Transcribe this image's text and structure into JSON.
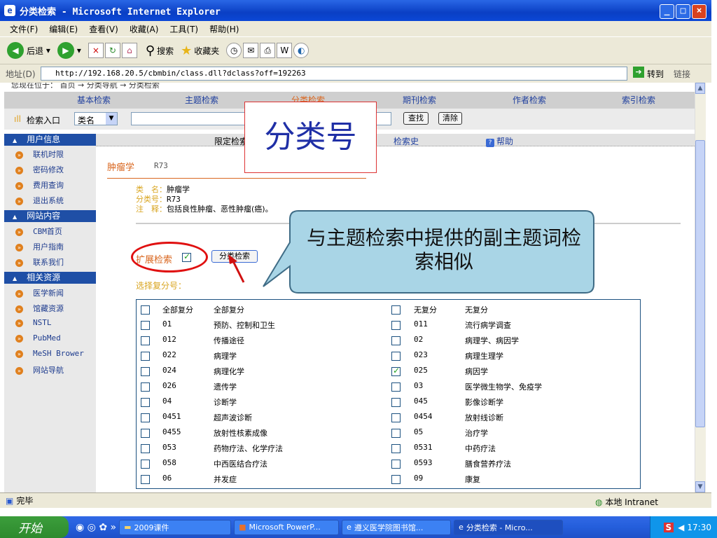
{
  "window": {
    "title": "分类检索 - Microsoft Internet Explorer"
  },
  "menu": [
    "文件(F)",
    "编辑(E)",
    "查看(V)",
    "收藏(A)",
    "工具(T)",
    "帮助(H)"
  ],
  "toolbar": {
    "back": "后退",
    "search": "搜索",
    "favorites": "收藏夹"
  },
  "address": {
    "label": "地址(D)",
    "url": "http://192.168.20.5/cbmbin/class.dll?dclass?off=192263",
    "go": "转到",
    "links": "链接"
  },
  "breadcrumb": "您现在位于： 首页 → 分类导航 → 分类检索",
  "nav": {
    "tabs": [
      "基本检索",
      "主题检索",
      "分类检索",
      "期刊检索",
      "作者检索",
      "索引检索"
    ]
  },
  "searchbar": {
    "label": "检索入口",
    "select": "类名",
    "find": "查找",
    "clear": "清除"
  },
  "subnav": {
    "limit": "限定检索",
    "history": "检索史",
    "help": "帮助"
  },
  "sidebar": {
    "sections": [
      {
        "title": "用户信息",
        "items": [
          "联机时限",
          "密码修改",
          "费用查询",
          "退出系统"
        ]
      },
      {
        "title": "网站内容",
        "items": [
          "CBM首页",
          "用户指南",
          "联系我们"
        ]
      },
      {
        "title": "相关资源",
        "items": [
          "医学新闻",
          "馆藏资源",
          "NSTL",
          "PubMed",
          "MeSH Brower",
          "网站导航"
        ]
      }
    ]
  },
  "category": {
    "name": "肿瘤学",
    "code": "R73"
  },
  "info": {
    "name_label": "类　名：",
    "name": "肿瘤学",
    "code_label": "分类号：",
    "code": "R73",
    "note_label": "注　释：",
    "note": "包括良性肿瘤、恶性肿瘤(癌)。"
  },
  "expand": {
    "label": "扩展检索",
    "button": "分类检索",
    "select_label": "选择复分号："
  },
  "subdivisions": [
    {
      "code": "全部复分",
      "name": "全部复分",
      "code2": "无复分",
      "name2": "无复分",
      "on2": false
    },
    {
      "code": "01",
      "name": "预防、控制和卫生",
      "code2": "011",
      "name2": "流行病学调查",
      "on2": false
    },
    {
      "code": "012",
      "name": "传播途径",
      "code2": "02",
      "name2": "病理学、病因学",
      "on2": false
    },
    {
      "code": "022",
      "name": "病理学",
      "code2": "023",
      "name2": "病理生理学",
      "on2": false
    },
    {
      "code": "024",
      "name": "病理化学",
      "code2": "025",
      "name2": "病因学",
      "on2": true
    },
    {
      "code": "026",
      "name": "遗传学",
      "code2": "03",
      "name2": "医学微生物学、免疫学",
      "on2": false
    },
    {
      "code": "04",
      "name": "诊断学",
      "code2": "045",
      "name2": "影像诊断学",
      "on2": false
    },
    {
      "code": "0451",
      "name": "超声波诊断",
      "code2": "0454",
      "name2": "放射线诊断",
      "on2": false
    },
    {
      "code": "0455",
      "name": "放射性核素成像",
      "code2": "05",
      "name2": "治疗学",
      "on2": false
    },
    {
      "code": "053",
      "name": "药物疗法、化学疗法",
      "code2": "0531",
      "name2": "中药疗法",
      "on2": false
    },
    {
      "code": "058",
      "name": "中西医结合疗法",
      "code2": "0593",
      "name2": "膳食营养疗法",
      "on2": false
    },
    {
      "code": "06",
      "name": "并发症",
      "code2": "09",
      "name2": "康复",
      "on2": false
    }
  ],
  "annotations": {
    "box": "分类号",
    "callout": "与主题检索中提供的副主题词检索相似"
  },
  "status": {
    "left": "完毕",
    "zone": "本地 Intranet"
  },
  "taskbar": {
    "start": "开始",
    "tasks": [
      "2009课件",
      "Microsoft PowerP...",
      "遵义医学院图书馆...",
      "分类检索 - Micro..."
    ],
    "clock": "17:30"
  },
  "colors": {
    "accent": "#1f4fa6",
    "orange": "#d9661f",
    "callout": "#a9d5e6"
  }
}
